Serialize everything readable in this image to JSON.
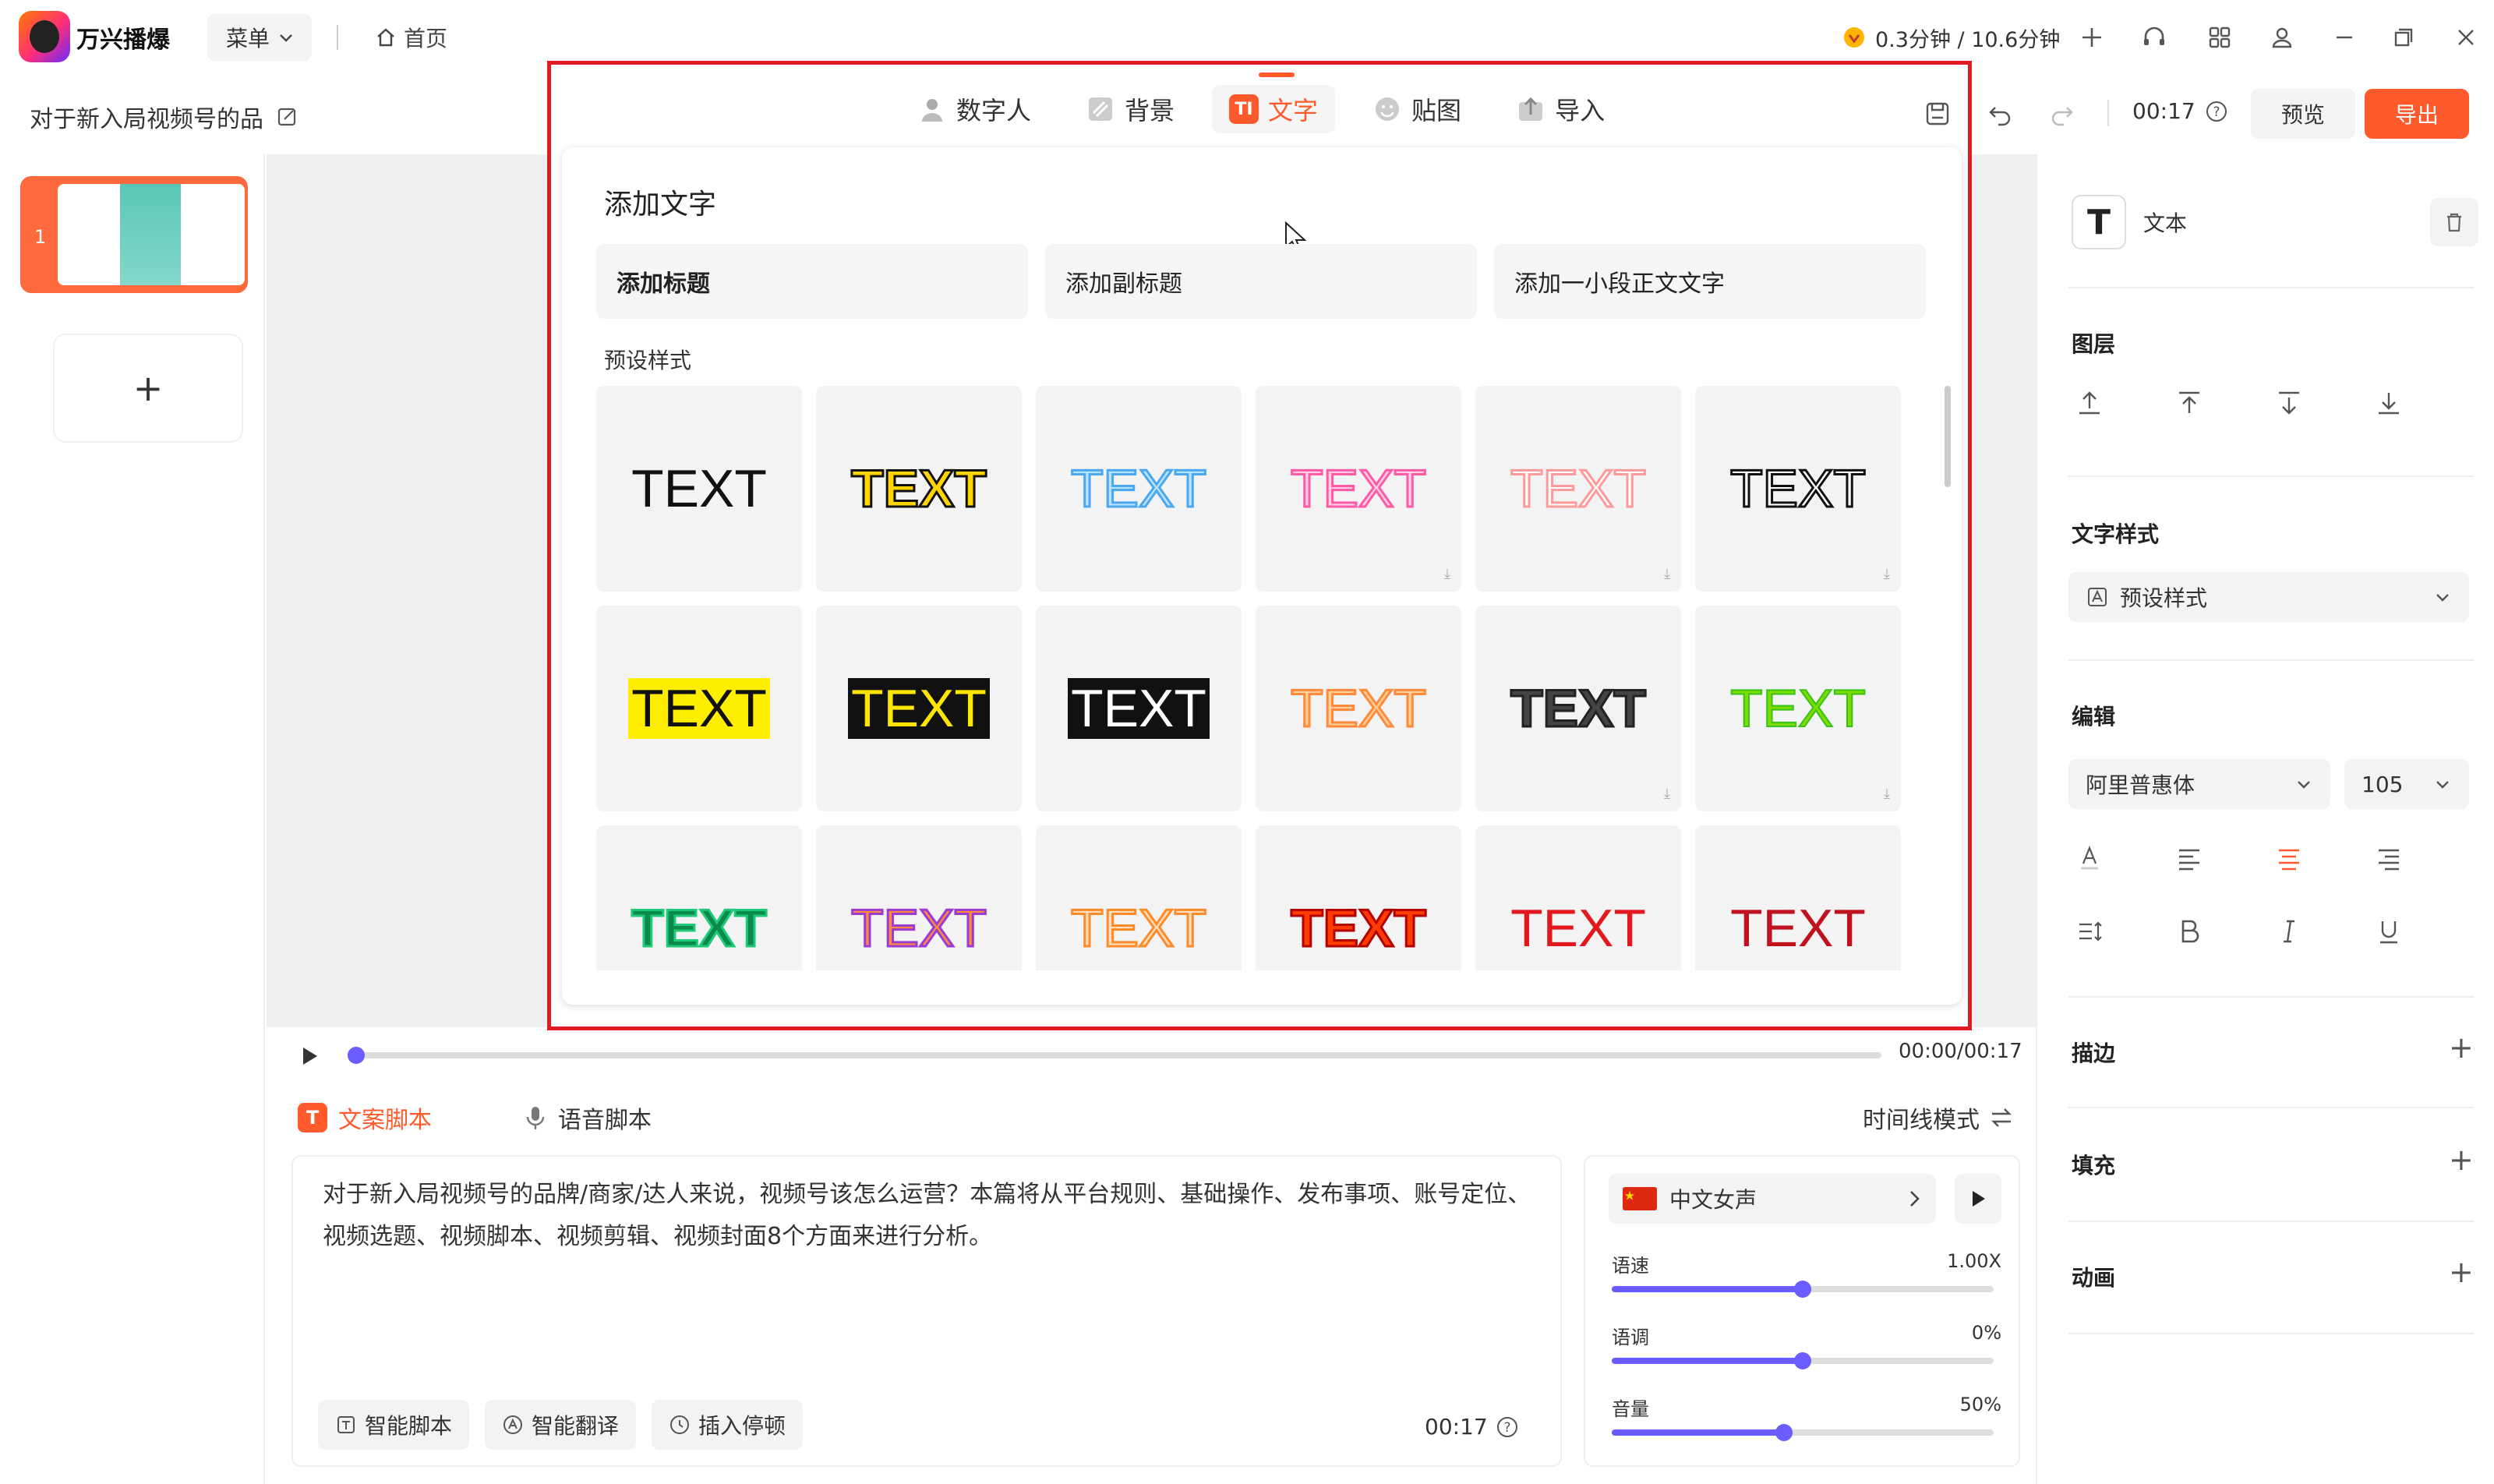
{
  "app": {
    "name": "万兴播爆",
    "menu_label": "菜单",
    "home_label": "首页",
    "quota": "0.3分钟 / 10.6分钟"
  },
  "project": {
    "title": "对于新入局视频号的品",
    "duration": "00:17",
    "preview_label": "预览",
    "export_label": "导出"
  },
  "slides": {
    "items": [
      {
        "index": "1"
      }
    ],
    "add_symbol": "+"
  },
  "popup": {
    "tabs": [
      {
        "label": "数字人",
        "icon": "digital-human-icon"
      },
      {
        "label": "背景",
        "icon": "background-icon"
      },
      {
        "label": "文字",
        "icon": "text-icon",
        "badge": "TI",
        "active": true
      },
      {
        "label": "贴图",
        "icon": "sticker-icon"
      },
      {
        "label": "导入",
        "icon": "import-icon"
      }
    ],
    "title": "添加文字",
    "add_buttons": [
      "添加标题",
      "添加副标题",
      "添加一小段正文文字"
    ],
    "presets_title": "预设样式",
    "preset_text": "TEXT",
    "presets": [
      {
        "style": "plain-black",
        "download": false
      },
      {
        "style": "yellow-black-outline",
        "download": false
      },
      {
        "style": "blue-outline",
        "download": false
      },
      {
        "style": "pink-outline",
        "download": true
      },
      {
        "style": "light-pink-outline",
        "download": true
      },
      {
        "style": "white-black-outline",
        "download": true
      },
      {
        "style": "black-on-yellow",
        "download": false
      },
      {
        "style": "yellow-on-black",
        "download": false
      },
      {
        "style": "white-on-black",
        "download": false
      },
      {
        "style": "orange-gradient",
        "download": false
      },
      {
        "style": "dark-outline",
        "download": true
      },
      {
        "style": "green-gradient",
        "download": true
      },
      {
        "style": "green-gradient-2",
        "download": false
      },
      {
        "style": "purple-orange",
        "download": false
      },
      {
        "style": "orange-outline",
        "download": false
      },
      {
        "style": "red-yellow",
        "download": false
      },
      {
        "style": "red-plain",
        "download": false
      },
      {
        "style": "dark-red-plain",
        "download": false
      }
    ]
  },
  "player": {
    "time": "00:00/00:17",
    "progress": 0.0
  },
  "script": {
    "tab_script": "文案脚本",
    "tab_voice": "语音脚本",
    "timeline_mode": "时间线模式",
    "text": "对于新入局视频号的品牌/商家/达人来说，视频号该怎么运营？本篇将从平台规则、基础操作、发布事项、账号定位、视频选题、视频脚本、视频剪辑、视频封面8个方面来进行分析。",
    "chips": [
      "智能脚本",
      "智能翻译",
      "插入停顿"
    ],
    "duration": "00:17"
  },
  "voice": {
    "name": "中文女声",
    "sliders": [
      {
        "label": "语速",
        "value": "1.00X",
        "level": 0.5
      },
      {
        "label": "语调",
        "value": "0%",
        "level": 0.5
      },
      {
        "label": "音量",
        "value": "50%",
        "level": 0.45
      }
    ]
  },
  "properties": {
    "element_label": "文本",
    "layer_title": "图层",
    "text_style_title": "文字样式",
    "text_style_value": "预设样式",
    "edit_title": "编辑",
    "font_value": "阿里普惠体",
    "size_value": "105",
    "stroke_title": "描边",
    "fill_title": "填充",
    "animation_title": "动画",
    "plus": "+"
  },
  "colors": {
    "accent": "#ff5a2c",
    "slider": "#6b5cff",
    "highlight": "#e01b24",
    "teal": "#3cc3a0"
  }
}
